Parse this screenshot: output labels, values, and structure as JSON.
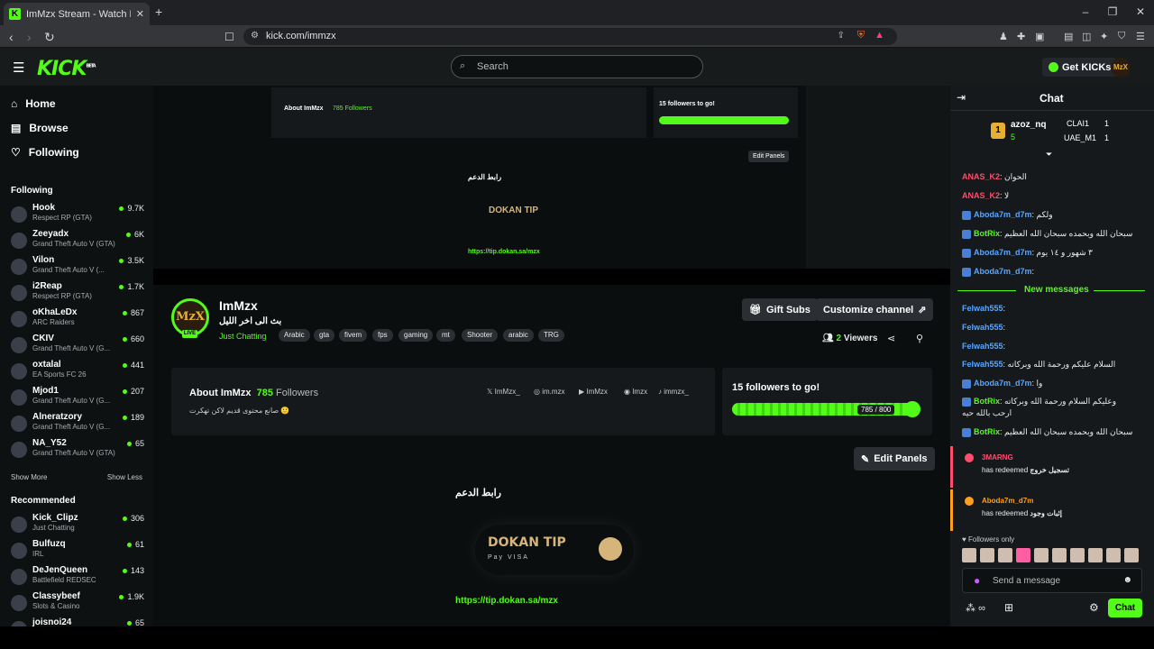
{
  "browser": {
    "tab_title": "ImMzx Stream - Watch Live on K",
    "url": "kick.com/immzx"
  },
  "topnav": {
    "logo": "KICK",
    "logo_badge": "BETA",
    "search_placeholder": "Search",
    "get_kicks": "Get KICKs",
    "avatar_text": "MzX"
  },
  "sidebar": {
    "nav": [
      {
        "label": "Home",
        "icon": "home-icon"
      },
      {
        "label": "Browse",
        "icon": "browse-icon"
      },
      {
        "label": "Following",
        "icon": "heart-icon"
      }
    ],
    "following_title": "Following",
    "following": [
      {
        "name": "Hook",
        "category": "Respect RP (GTA)",
        "viewers": "9.7K"
      },
      {
        "name": "Zeeyadx",
        "category": "Grand Theft Auto V (GTA)",
        "viewers": "6K"
      },
      {
        "name": "Vilon",
        "category": "Grand Theft Auto V (...",
        "viewers": "3.5K"
      },
      {
        "name": "i2Reap",
        "category": "Respect RP (GTA)",
        "viewers": "1.7K"
      },
      {
        "name": "oKhaLeDx",
        "category": "ARC Raiders",
        "viewers": "867"
      },
      {
        "name": "CKIV",
        "category": "Grand Theft Auto V (G...",
        "viewers": "660"
      },
      {
        "name": "oxtalal",
        "category": "EA Sports FC 26",
        "viewers": "441"
      },
      {
        "name": "Mjod1",
        "category": "Grand Theft Auto V (G...",
        "viewers": "207"
      },
      {
        "name": "Alneratzory",
        "category": "Grand Theft Auto V (G...",
        "viewers": "189"
      },
      {
        "name": "NA_Y52",
        "category": "Grand Theft Auto V (GTA)",
        "viewers": "65"
      }
    ],
    "show_more": "Show More",
    "show_less": "Show Less",
    "recommended_title": "Recommended",
    "recommended": [
      {
        "name": "Kick_Clipz",
        "category": "Just Chatting",
        "viewers": "306"
      },
      {
        "name": "Bulfuzq",
        "category": "IRL",
        "viewers": "61"
      },
      {
        "name": "DeJenQueen",
        "category": "Battlefield REDSEC",
        "viewers": "143"
      },
      {
        "name": "Classybeef",
        "category": "Slots & Casino",
        "viewers": "1.9K"
      },
      {
        "name": "joisnoi24",
        "category": "",
        "viewers": "65"
      }
    ]
  },
  "channel": {
    "avatar_text": "MzX",
    "live_badge": "LIVE",
    "name": "ImMzx",
    "stream_title": "بث الى اخر الليل",
    "category": "Just Chatting",
    "tags": [
      "Arabic",
      "gta",
      "fivem",
      "fps",
      "gaming",
      "mt",
      "Shooter",
      "arabic",
      "TRG"
    ],
    "gift_subs": "Gift Subs",
    "customize": "Customize channel",
    "viewers_count": "2",
    "viewers_label": "Viewers"
  },
  "about": {
    "title": "About ImMzx",
    "followers_count": "785",
    "followers_label": "Followers",
    "description": "صانع محتوى قديم لاكن تهكرت 🙂",
    "socials": [
      "ImMzx_",
      "im.mzx",
      "ImMzx",
      "Imzx",
      "immzx_"
    ]
  },
  "goal": {
    "title": "15 followers to go!",
    "progress_text": "785 / 800",
    "progress": 0.98
  },
  "panels": {
    "edit_panels": "Edit Panels",
    "support_title": "رابط الدعم",
    "dokan_wordmark": "DOKAN TIP",
    "dokan_pay": "Pay  VISA",
    "link": "https://tip.dokan.sa/mzx"
  },
  "player_preview": {
    "about": "About ImMzx",
    "followers": "785 Followers",
    "goal": "15 followers to go!",
    "edit_panels": "Edit Panels",
    "support": "رابط الدعم",
    "link": "https://tip.dokan.sa/mzx"
  },
  "chat": {
    "title": "Chat",
    "leaderboard": [
      {
        "rank": "1",
        "name": "azoz_nq",
        "count": "5"
      },
      {
        "name": "CLAI1",
        "count": "1"
      },
      {
        "name": "UAE_M1",
        "count": "1"
      }
    ],
    "messages": [
      {
        "user": "ANAS_K2",
        "color": "#ff4d6d",
        "text": "الحوان"
      },
      {
        "user": "ANAS_K2",
        "color": "#ff4d6d",
        "text": "لا"
      },
      {
        "user": "Aboda7m_d7m",
        "color": "#59a6ff",
        "text": "ولكم",
        "badge": true
      },
      {
        "user": "BotRix",
        "color": "#53fc18",
        "text": "سبحان الله وبحمده سبحان الله العظيم",
        "badge": true
      },
      {
        "user": "Aboda7m_d7m",
        "color": "#59a6ff",
        "text": "٣ شهور و ١٤ يوم",
        "badge": true
      },
      {
        "user": "Aboda7m_d7m",
        "color": "#59a6ff",
        "text": "",
        "badge": true
      }
    ],
    "new_messages": "New messages",
    "messages_after": [
      {
        "user": "Felwah555",
        "color": "#59a6ff",
        "text": ""
      },
      {
        "user": "Felwah555",
        "color": "#59a6ff",
        "text": ""
      },
      {
        "user": "Felwah555",
        "color": "#59a6ff",
        "text": ""
      },
      {
        "user": "Felwah555",
        "color": "#59a6ff",
        "text": "السلام عليكم ورحمة الله وبركاته"
      },
      {
        "user": "Aboda7m_d7m",
        "color": "#59a6ff",
        "text": "وا",
        "badge": true
      },
      {
        "user": "BotRix",
        "color": "#53fc18",
        "text": "وعليكم السلام ورحمة الله وبركاته",
        "badge": true
      },
      {
        "user": "",
        "color": "#e8eaeb",
        "text": "ارحب بالله حيه"
      },
      {
        "user": "BotRix",
        "color": "#53fc18",
        "text": "سبحان الله وبحمده سبحان الله العظيم",
        "badge": true
      }
    ],
    "redeems": [
      {
        "user": "3MARNG",
        "color": "#ff4d6d",
        "action": "has redeemed",
        "reward": "تسجيل خروج"
      },
      {
        "user": "Aboda7m_d7m",
        "color": "#ff9f1a",
        "action": "has redeemed",
        "reward": "إثبات وجود"
      }
    ],
    "followers_only": "Followers only",
    "input_placeholder": "Send a message",
    "send": "Chat",
    "points": "∞"
  }
}
